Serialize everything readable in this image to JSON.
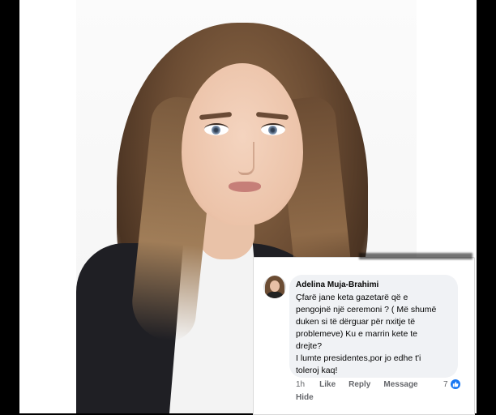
{
  "comment": {
    "author": "Adelina Muja-Brahimi",
    "lines": [
      "Çfarë jane keta gazetarë që e",
      "pengojnë një ceremoni ? ( Më shumë",
      "duken si të dërguar për nxitje të",
      "problemeve) Ku e marrin kete te",
      "drejte?",
      "I lumte presidentes,por jo edhe t'i",
      "toleroj kaq!"
    ],
    "time": "1h",
    "like_label": "Like",
    "reply_label": "Reply",
    "message_label": "Message",
    "hide_label": "Hide",
    "reaction_count": "7",
    "reaction_icon": "thumbs-up-icon"
  },
  "colors": {
    "bubble": "#f0f2f5",
    "meta_text": "#65676b",
    "like_blue": "#1877f2",
    "jacket": "#1f1f24"
  }
}
